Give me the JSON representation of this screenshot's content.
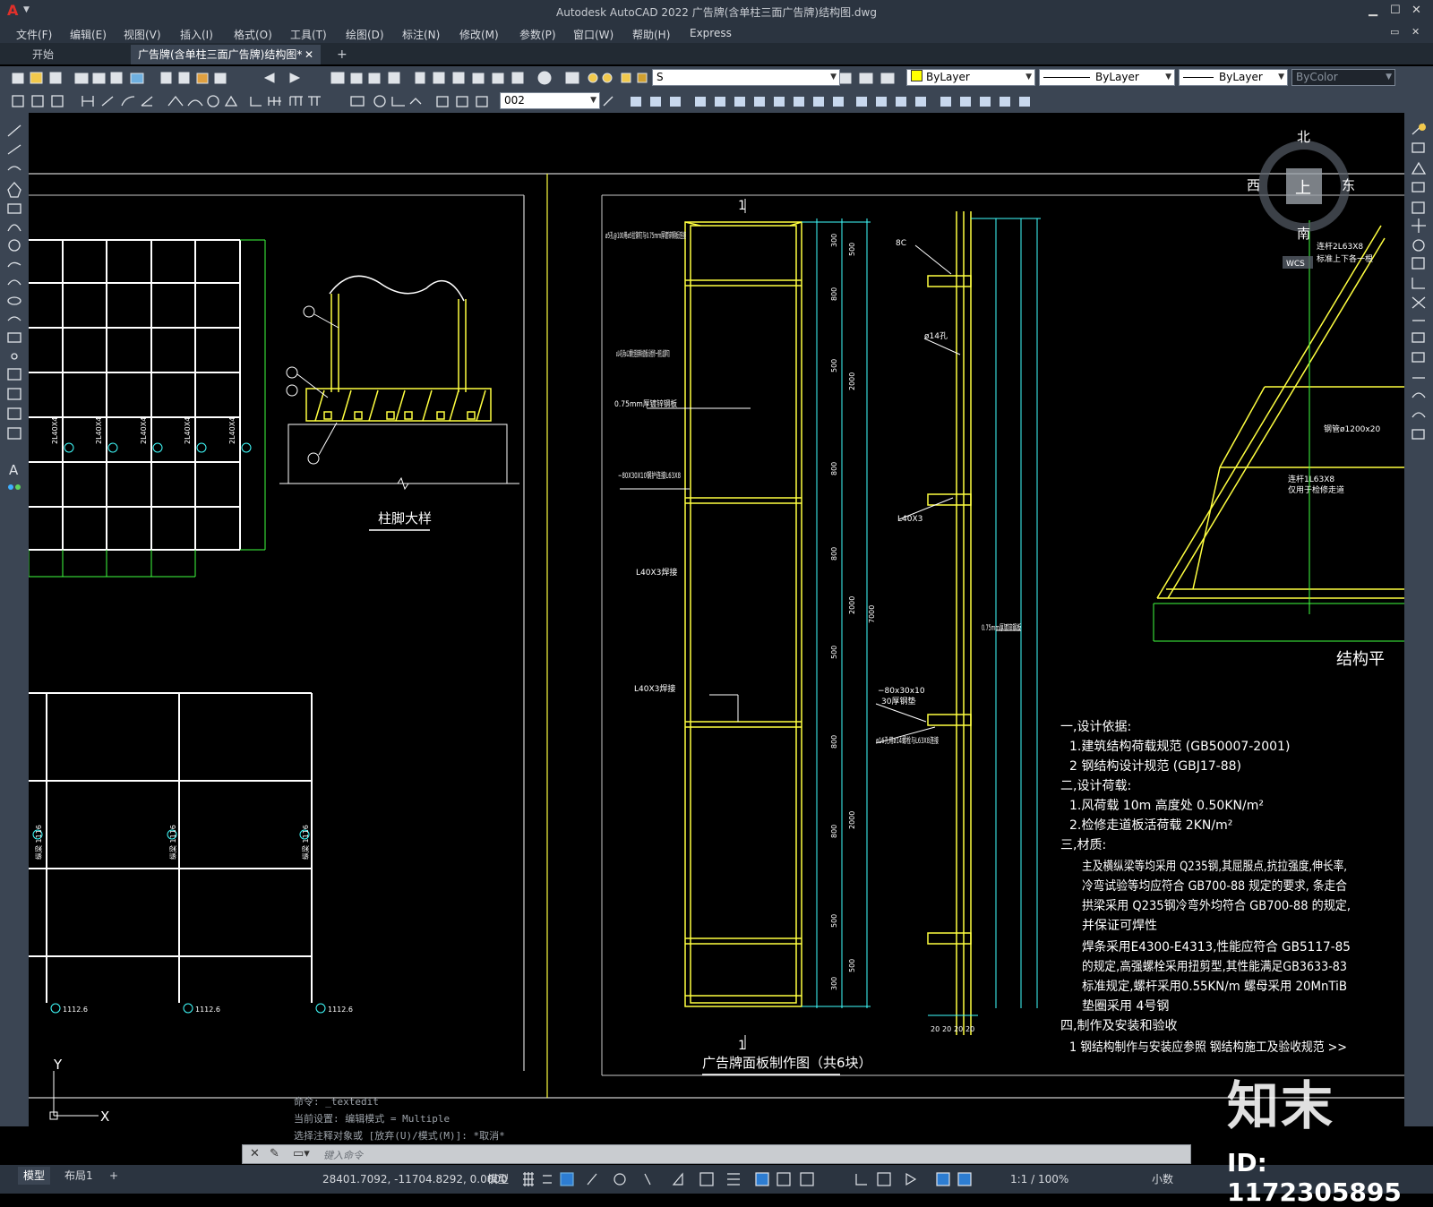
{
  "window": {
    "logo": "A",
    "title": "Autodesk AutoCAD 2022    广告牌(含单柱三面广告牌)结构图.dwg"
  },
  "menu": [
    "文件(F)",
    "编辑(E)",
    "视图(V)",
    "插入(I)",
    "格式(O)",
    "工具(T)",
    "绘图(D)",
    "标注(N)",
    "修改(M)",
    "参数(P)",
    "窗口(W)",
    "帮助(H)",
    "Express"
  ],
  "tabs": {
    "start": "开始",
    "doc": "广告牌(含单柱三面广告牌)结构图*",
    "add": "+"
  },
  "toolbar": {
    "layer_value": "S",
    "color_value": "ByLayer",
    "linetype_value": "ByLayer",
    "lineweight_value": "ByLayer",
    "plotstyle_value": "ByColor",
    "dimstyle_value": "002"
  },
  "viewcube": {
    "north": "北",
    "south": "南",
    "east": "东",
    "west": "西",
    "top": "上",
    "wcs": "WCS"
  },
  "drawing": {
    "column_foot_title": "柱脚大样",
    "panel_title": "广告牌面板制作图（共6块）",
    "structure_plan_title": "结构平",
    "section_mark": "1",
    "grid_labels": [
      "2L40X4",
      "2L40X4",
      "2L40X4",
      "2L40X4",
      "2L40X4"
    ],
    "beam_labels": [
      "纵梁 1116",
      "纵梁 1116",
      "纵梁 1116"
    ],
    "bottom_labels": [
      "1112.6",
      "1112.6",
      "1112.6"
    ],
    "panel_annotations": [
      "ø5孔@100用ø5拉铆钉与0.75mm厚镀锌钢板连接",
      "ø14孔用ø12螺栓连接两块面板(设检修一侧孔或铆钉)",
      "0.75mm厚镀锌钢板",
      "−80X30X10钢护连接L63X8",
      "L40X3焊接",
      "L40X3焊接"
    ],
    "side_annotations": [
      "8C",
      "ø14孔",
      "L40X3",
      "0.75mm厚镀锌钢板",
      "−80x30x10",
      "30厚钢垫",
      "ø16孔用ø14螺栓与L63X8连接"
    ],
    "plan_annotations": [
      "连杆2L63X8",
      "标准上下各一根",
      "钢管ø1200x20",
      "连杆1L63X8",
      "仅用于检修走道"
    ],
    "dims_left": [
      "300",
      "800",
      "500",
      "800",
      "800",
      "500",
      "800",
      "800",
      "500",
      "800",
      "800",
      "300"
    ],
    "dims_right": [
      "500",
      "2000",
      "2000",
      "2000",
      "500"
    ],
    "dim_total": "7000",
    "dim_bottom": [
      "20",
      "20",
      "20",
      "20"
    ],
    "notes": [
      "一,设计依据:",
      "1.建筑结构荷载规范    (GB50007-2001)",
      "2 钢结构设计规范      (GBJ17-88)",
      "二,设计荷载:",
      "1.风荷载 10m 高度处 0.50KN/m²",
      "2.检修走道板活荷载   2KN/m²",
      "三,材质:",
      "主及横纵梁等均采用 Q235钢,其屈服点,抗拉强度,伸长率,",
      "冷弯试验等均应符合 GB700-88 规定的要求, 条走合",
      "拱梁采用 Q235钢冷弯外均符合   GB700-88 的规定,",
      "并保证可焊性",
      "焊条采用E4300-E4313,性能应符合    GB5117-85",
      "的规定,高强螺栓采用扭剪型,其性能满足GB3633-83",
      "标准规定,螺杆采用0.55KN/m 螺母采用 20MnTiB",
      "垫圈采用 4号钢",
      "四,制作及安装和验收",
      "1 钢结构制作与安装应参照  钢结构施工及验收规范   >>"
    ],
    "ucs_y": "Y",
    "ucs_x": "X"
  },
  "command": {
    "history": [
      "命令: _textedit",
      "当前设置: 编辑模式 = Multiple",
      "选择注释对象或 [放弃(U)/模式(M)]: *取消*"
    ],
    "placeholder": "键入命令"
  },
  "status": {
    "model_tab": "模型",
    "layout_tab": "布局1",
    "coords": "28401.7092, -11704.8292, 0.0000",
    "space": "模型",
    "scale": "1:1 / 100%",
    "units": "小数"
  },
  "watermark": {
    "brand": "知末",
    "id": "ID: 1172305895"
  }
}
